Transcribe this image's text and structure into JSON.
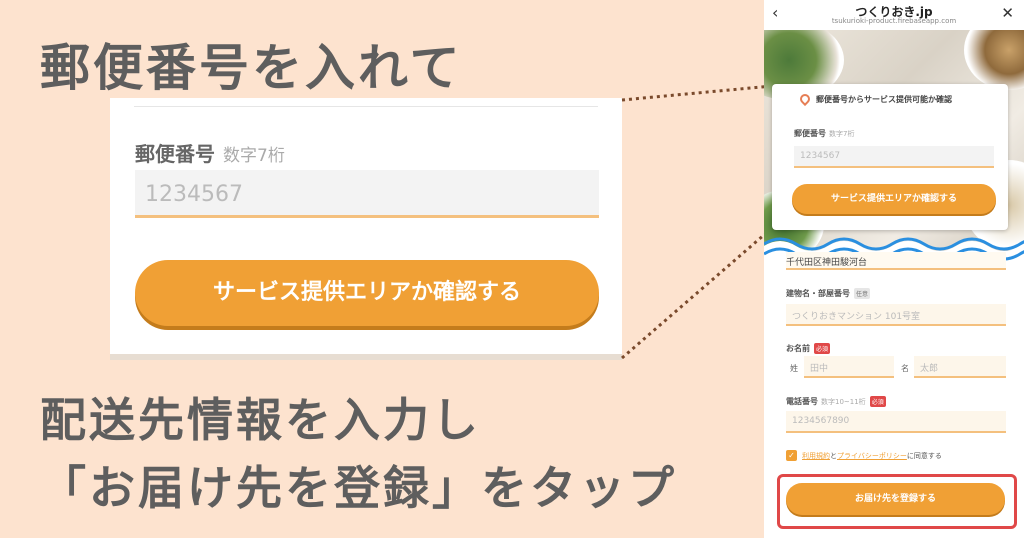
{
  "headings": {
    "step1": "郵便番号を入れて",
    "step2_line1": "配送先情報を入力し",
    "step2_line2": "「お届け先を登録」をタップ"
  },
  "zoom": {
    "postal_label": "郵便番号",
    "postal_hint": "数字7桁",
    "postal_placeholder": "1234567",
    "check_button": "サービス提供エリアか確認する"
  },
  "phone": {
    "back_icon": "chevron-left-icon",
    "title": "つくりおき.jp",
    "url": "tsukurioki-product.firebaseapp.com",
    "close_icon": "close-icon",
    "card": {
      "title": "郵便番号からサービス提供可能か確認",
      "postal_label": "郵便番号",
      "postal_hint": "数字7桁",
      "postal_placeholder": "1234567",
      "check_button": "サービス提供エリアか確認する"
    },
    "form": {
      "address_value": "千代田区神田駿河台",
      "building_label": "建物名・部屋番号",
      "building_tag": "任意",
      "building_placeholder": "つくりおきマンション 101号室",
      "name_label": "お名前",
      "name_tag": "必須",
      "last_prefix": "姓",
      "last_placeholder": "田中",
      "first_prefix": "名",
      "first_placeholder": "太郎",
      "phone_label": "電話番号",
      "phone_hint": "数字10~11桁",
      "phone_tag": "必須",
      "phone_placeholder": "1234567890",
      "terms_link": "利用規約",
      "and_text": "と",
      "privacy_link": "プライバシーポリシー",
      "agree_text": "に同意する",
      "agree_checked": true,
      "submit_button": "お届け先を登録する"
    }
  },
  "colors": {
    "background": "#fde3cf",
    "accent": "#f0a035",
    "highlight": "#e04848",
    "wave": "#2a8fe0"
  }
}
